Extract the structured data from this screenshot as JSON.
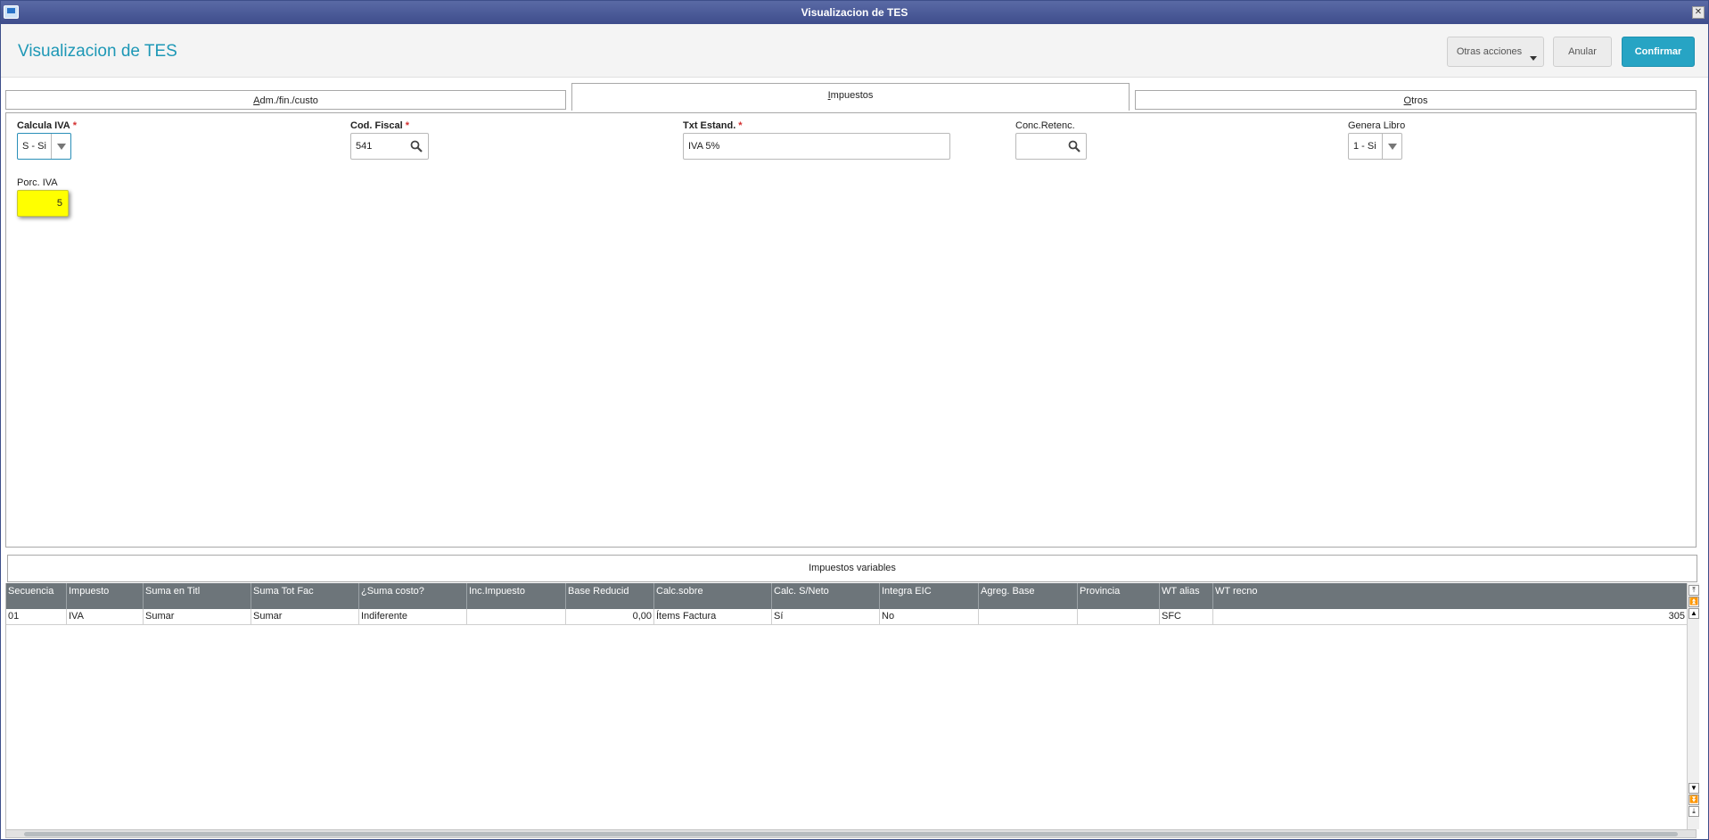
{
  "window": {
    "title": "Visualizacion de TES",
    "close_glyph": "✕"
  },
  "header": {
    "page_title": "Visualizacion de TES",
    "buttons": {
      "otras_acciones": "Otras acciones",
      "anular": "Anular",
      "confirmar": "Confirmar"
    }
  },
  "tabs": [
    {
      "label_pre": "",
      "label_ul": "A",
      "label_post": "dm./fin./custo"
    },
    {
      "label_pre": "",
      "label_ul": "I",
      "label_post": "mpuestos",
      "active": true
    },
    {
      "label_pre": "",
      "label_ul": "O",
      "label_post": "tros"
    }
  ],
  "fields": {
    "calcula_iva": {
      "label": "Calcula IVA",
      "required": "*",
      "value": "S - Si"
    },
    "cod_fiscal": {
      "label": "Cod. Fiscal",
      "required": "*",
      "value": "541"
    },
    "txt_estand": {
      "label": "Txt Estand.",
      "required": "*",
      "value": "IVA 5%"
    },
    "conc_retenc": {
      "label": "Conc.Retenc.",
      "value": ""
    },
    "genera_libro": {
      "label": "Genera Libro",
      "value": "1 - Si"
    },
    "porc_iva": {
      "label": "Porc. IVA",
      "value": "5"
    }
  },
  "impuestos_variables": {
    "title": "Impuestos variables",
    "columns": [
      "Secuencia",
      "Impuesto",
      "Suma en Titl",
      "Suma Tot Fac",
      "¿Suma costo?",
      "Inc.Impuesto",
      "Base Reducid",
      "Calc.sobre",
      "Calc. S/Neto",
      "Integra EIC",
      "Agreg. Base",
      "Provincia",
      "WT alias",
      "WT recno"
    ],
    "rows": [
      [
        "01",
        "IVA",
        "Sumar",
        "Sumar",
        "Indiferente",
        "",
        "0,00",
        "Ítems Factura",
        "Sí",
        "No",
        "",
        "",
        "SFC",
        "305"
      ]
    ]
  },
  "colors": {
    "accent": "#27a4c4",
    "title_blue": "#1e98b6",
    "highlight_yellow": "#ffff00",
    "titlebar": "#4a5a98"
  },
  "icons": {
    "search": "search-icon",
    "dropdown": "chevron-down-icon"
  }
}
